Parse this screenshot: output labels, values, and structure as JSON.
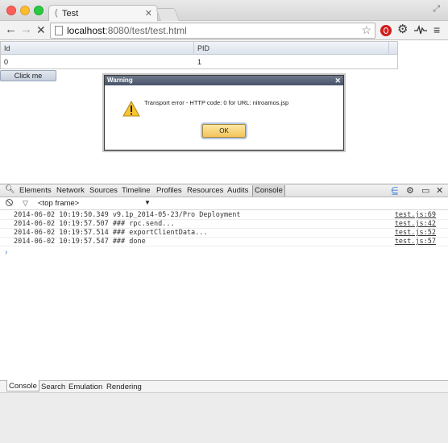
{
  "browser": {
    "tab_title": "Test",
    "url_host": "localhost",
    "url_rest": ":8080/test/test.html"
  },
  "grid": {
    "columns": [
      "Id",
      "PID"
    ],
    "rows": [
      [
        "0",
        "1"
      ]
    ]
  },
  "page": {
    "click_button": "Click me"
  },
  "dialog": {
    "title": "Warning",
    "message": "Transport error - HTTP code: 0 for URL: nitroamos.jsp",
    "ok_label": "OK"
  },
  "devtools": {
    "tabs": [
      "Elements",
      "Network",
      "Sources",
      "Timeline",
      "Profiles",
      "Resources",
      "Audits",
      "Console"
    ],
    "active_tab": "Console",
    "frame_selector": "<top frame>",
    "console": [
      {
        "text": "2014-06-02 10:19:50.349  v9.1p_2014-05-23/Pro Deployment",
        "source": "test.js:69"
      },
      {
        "text": "2014-06-02 10:19:57.507  ### rpc.send...",
        "source": "test.js:42"
      },
      {
        "text": "2014-06-02 10:19:57.514  ### exportClientData...",
        "source": "test.js:52"
      },
      {
        "text": "2014-06-02 10:19:57.547  ### done",
        "source": "test.js:57"
      }
    ],
    "drawer_tabs": [
      "Console",
      "Search",
      "Emulation",
      "Rendering"
    ],
    "active_drawer_tab": "Console",
    "prompt_glyph": "›"
  }
}
